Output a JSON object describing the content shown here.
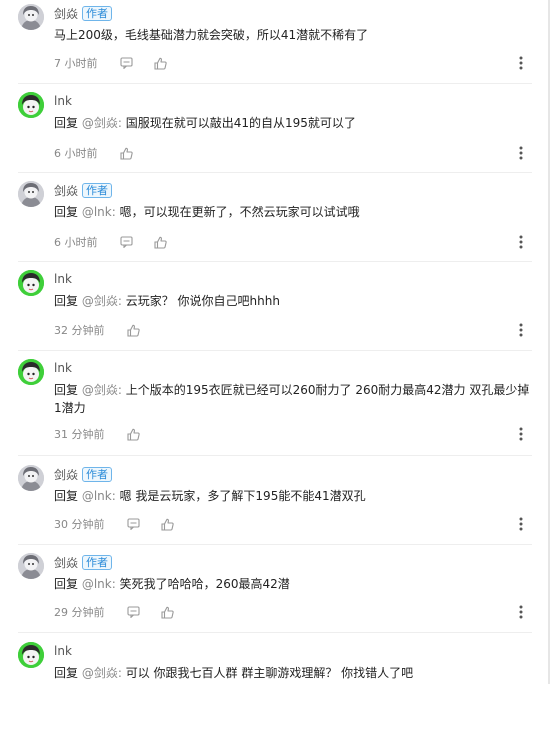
{
  "labels": {
    "reply": "回复",
    "author_badge": "作者"
  },
  "comments": [
    {
      "user": "剑焱",
      "is_author": true,
      "reply_to": "",
      "text": "马上200级，毛线基础潜力就会突破，所以41潜就不稀有了",
      "time": "7 小时前",
      "avatar": "gray",
      "icons": [
        "comment-icon",
        "like-icon"
      ]
    },
    {
      "user": "lnk",
      "is_author": false,
      "reply_to": "@剑焱:",
      "text": "国服现在就可以敲出41的自从195就可以了",
      "time": "6 小时前",
      "avatar": "green",
      "icons": [
        "like-icon"
      ]
    },
    {
      "user": "剑焱",
      "is_author": true,
      "reply_to": "@lnk:",
      "text": "嗯，可以现在更新了，不然云玩家可以试试哦",
      "time": "6 小时前",
      "avatar": "gray",
      "icons": [
        "comment-icon",
        "like-icon"
      ]
    },
    {
      "user": "lnk",
      "is_author": false,
      "reply_to": "@剑焱:",
      "text": "云玩家？ 你说你自己吧hhhh",
      "time": "32 分钟前",
      "avatar": "green",
      "icons": [
        "like-icon"
      ]
    },
    {
      "user": "lnk",
      "is_author": false,
      "reply_to": "@剑焱:",
      "text": "上个版本的195衣匠就已经可以260耐力了 260耐力最高42潜力 双孔最少掉1潜力",
      "time": "31 分钟前",
      "avatar": "green",
      "icons": [
        "like-icon"
      ]
    },
    {
      "user": "剑焱",
      "is_author": true,
      "reply_to": "@lnk:",
      "text": "嗯 我是云玩家，多了解下195能不能41潜双孔",
      "time": "30 分钟前",
      "avatar": "gray",
      "icons": [
        "comment-icon",
        "like-icon"
      ]
    },
    {
      "user": "剑焱",
      "is_author": true,
      "reply_to": "@lnk:",
      "text": "笑死我了哈哈哈，260最高42潜",
      "time": "29 分钟前",
      "avatar": "gray",
      "icons": [
        "comment-icon",
        "like-icon"
      ]
    },
    {
      "user": "lnk",
      "is_author": false,
      "reply_to": "@剑焱:",
      "text": "可以 你跟我七百人群 群主聊游戏理解？ 你找错人了吧",
      "time": "",
      "avatar": "green",
      "icons": []
    }
  ]
}
